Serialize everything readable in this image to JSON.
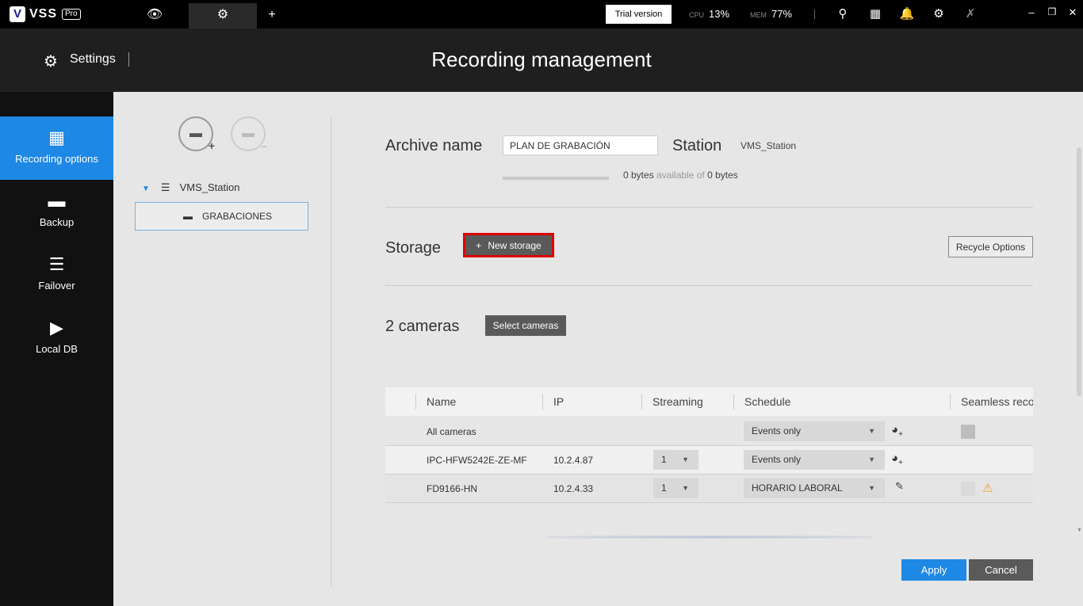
{
  "topbar": {
    "logo_mark": "V",
    "logo_text": "VSS",
    "logo_badge": "Pro",
    "trial_label": "Trial version",
    "cpu_label": "CPU",
    "cpu_value": "13%",
    "mem_label": "MEM",
    "mem_value": "77%"
  },
  "header": {
    "section_label": "Settings",
    "page_title": "Recording management"
  },
  "leftnav": {
    "items": [
      {
        "label": "Recording options"
      },
      {
        "label": "Backup"
      },
      {
        "label": "Failover"
      },
      {
        "label": "Local DB"
      }
    ]
  },
  "tree": {
    "station": "VMS_Station",
    "archive": "GRABACIONES"
  },
  "archive": {
    "name_label": "Archive name",
    "name_value": "PLAN DE GRABACIÓN",
    "station_label": "Station",
    "station_value": "VMS_Station",
    "capacity_used": "0 bytes",
    "capacity_mid": "available of",
    "capacity_total": "0 bytes",
    "capacity_fraction": 0
  },
  "storage": {
    "label": "Storage",
    "new_storage": "New storage",
    "recycle_options": "Recycle Options"
  },
  "cameras": {
    "label": "2 cameras",
    "select_button": "Select cameras"
  },
  "table": {
    "headers": [
      "Name",
      "IP",
      "Streaming",
      "Schedule",
      "Seamless reco"
    ],
    "all_row": {
      "name": "All cameras",
      "schedule": "Events only"
    },
    "rows": [
      {
        "name": "IPC-HFW5242E-ZE-MF",
        "ip": "10.2.4.87",
        "streaming": "1",
        "schedule": "Events only"
      },
      {
        "name": "FD9166-HN",
        "ip": "10.2.4.33",
        "streaming": "1",
        "schedule": "HORARIO LABORAL"
      }
    ]
  },
  "actions": {
    "apply": "Apply",
    "cancel": "Cancel"
  },
  "colors": {
    "accent": "#1e88e5",
    "highlight_outline": "#e00000",
    "warning": "#f0a500"
  }
}
